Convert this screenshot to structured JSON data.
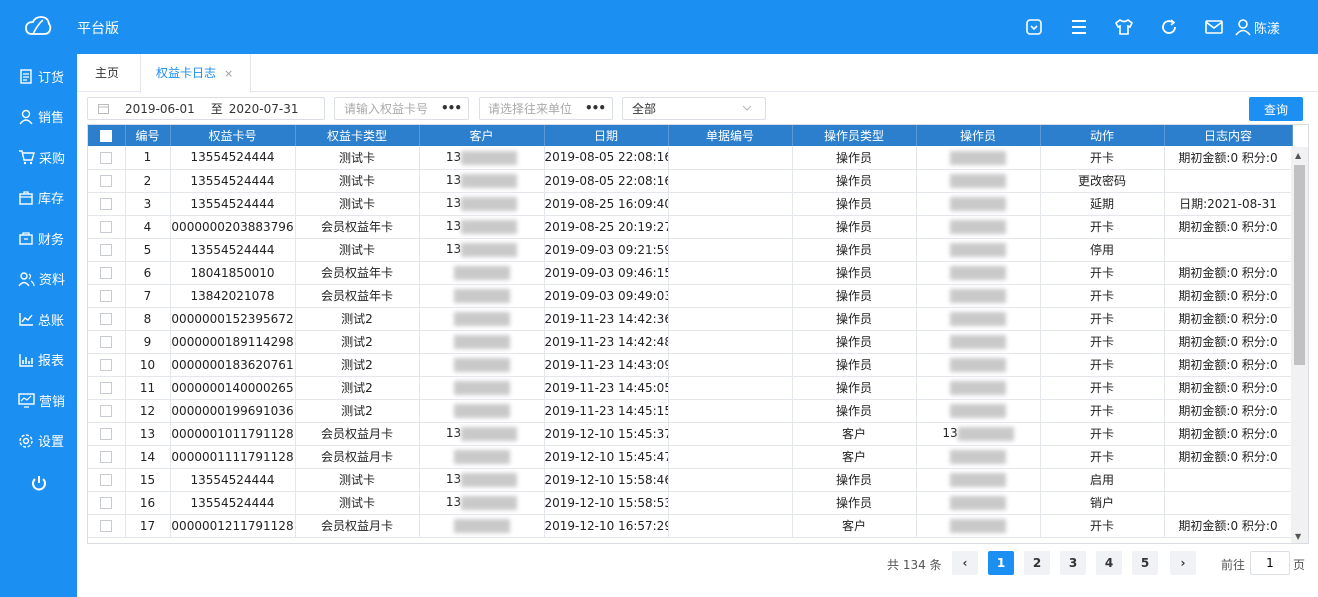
{
  "header": {
    "title": "平台版",
    "user": "陈漾"
  },
  "sidebar": {
    "items": [
      {
        "label": "订货",
        "icon": "clipboard-icon"
      },
      {
        "label": "销售",
        "icon": "user-icon"
      },
      {
        "label": "采购",
        "icon": "cart-icon"
      },
      {
        "label": "库存",
        "icon": "box-icon"
      },
      {
        "label": "财务",
        "icon": "wallet-icon"
      },
      {
        "label": "资料",
        "icon": "users-icon"
      },
      {
        "label": "总账",
        "icon": "chart-icon"
      },
      {
        "label": "报表",
        "icon": "report-icon"
      },
      {
        "label": "营销",
        "icon": "monitor-icon"
      },
      {
        "label": "设置",
        "icon": "gear-icon"
      }
    ]
  },
  "tabs": {
    "home": "主页",
    "active": "权益卡日志",
    "close": "×"
  },
  "filters": {
    "date_from": "2019-06-01",
    "date_sep": "至",
    "date_to": "2020-07-31",
    "card_placeholder": "请输入权益卡号",
    "unit_placeholder": "请选择往来单位",
    "select_value": "全部",
    "query_label": "查询"
  },
  "table": {
    "columns": [
      "编号",
      "权益卡号",
      "权益卡类型",
      "客户",
      "日期",
      "单据编号",
      "操作员类型",
      "操作员",
      "动作",
      "日志内容"
    ],
    "rows": [
      {
        "no": "1",
        "card": "13554524444",
        "type": "测试卡",
        "customer": "13",
        "date": "2019-08-05 22:08:16",
        "op_type": "操作员",
        "operator": "",
        "action": "开卡",
        "log": "期初金额:0 积分:0"
      },
      {
        "no": "2",
        "card": "13554524444",
        "type": "测试卡",
        "customer": "13",
        "date": "2019-08-05 22:08:16",
        "op_type": "操作员",
        "operator": "",
        "action": "更改密码",
        "log": ""
      },
      {
        "no": "3",
        "card": "13554524444",
        "type": "测试卡",
        "customer": "13",
        "date": "2019-08-25 16:09:40",
        "op_type": "操作员",
        "operator": "",
        "action": "延期",
        "log": "日期:2021-08-31"
      },
      {
        "no": "4",
        "card": "0000000203883796",
        "type": "会员权益年卡",
        "customer": "13",
        "date": "2019-08-25 20:19:27",
        "op_type": "操作员",
        "operator": "",
        "action": "开卡",
        "log": "期初金额:0 积分:0"
      },
      {
        "no": "5",
        "card": "13554524444",
        "type": "测试卡",
        "customer": "13",
        "date": "2019-09-03 09:21:59",
        "op_type": "操作员",
        "operator": "",
        "action": "停用",
        "log": ""
      },
      {
        "no": "6",
        "card": "18041850010",
        "type": "会员权益年卡",
        "customer": "",
        "date": "2019-09-03 09:46:15",
        "op_type": "操作员",
        "operator": "",
        "action": "开卡",
        "log": "期初金额:0 积分:0"
      },
      {
        "no": "7",
        "card": "13842021078",
        "type": "会员权益年卡",
        "customer": "",
        "date": "2019-09-03 09:49:03",
        "op_type": "操作员",
        "operator": "",
        "action": "开卡",
        "log": "期初金额:0 积分:0"
      },
      {
        "no": "8",
        "card": "0000000152395672",
        "type": "测试2",
        "customer": "",
        "date": "2019-11-23 14:42:36",
        "op_type": "操作员",
        "operator": "",
        "action": "开卡",
        "log": "期初金额:0 积分:0"
      },
      {
        "no": "9",
        "card": "0000000189114298",
        "type": "测试2",
        "customer": "",
        "date": "2019-11-23 14:42:48",
        "op_type": "操作员",
        "operator": "",
        "action": "开卡",
        "log": "期初金额:0 积分:0"
      },
      {
        "no": "10",
        "card": "0000000183620761",
        "type": "测试2",
        "customer": "",
        "date": "2019-11-23 14:43:09",
        "op_type": "操作员",
        "operator": "",
        "action": "开卡",
        "log": "期初金额:0 积分:0"
      },
      {
        "no": "11",
        "card": "0000000140000265",
        "type": "测试2",
        "customer": "",
        "date": "2019-11-23 14:45:05",
        "op_type": "操作员",
        "operator": "",
        "action": "开卡",
        "log": "期初金额:0 积分:0"
      },
      {
        "no": "12",
        "card": "0000000199691036",
        "type": "测试2",
        "customer": "",
        "date": "2019-11-23 14:45:15",
        "op_type": "操作员",
        "operator": "",
        "action": "开卡",
        "log": "期初金额:0 积分:0"
      },
      {
        "no": "13",
        "card": "0000001011791128",
        "type": "会员权益月卡",
        "customer": "13",
        "date": "2019-12-10 15:45:37",
        "op_type": "客户",
        "operator": "13",
        "action": "开卡",
        "log": "期初金额:0 积分:0"
      },
      {
        "no": "14",
        "card": "0000001111791128",
        "type": "会员权益月卡",
        "customer": "",
        "date": "2019-12-10 15:45:47",
        "op_type": "客户",
        "operator": "",
        "action": "开卡",
        "log": "期初金额:0 积分:0"
      },
      {
        "no": "15",
        "card": "13554524444",
        "type": "测试卡",
        "customer": "13",
        "date": "2019-12-10 15:58:46",
        "op_type": "操作员",
        "operator": "",
        "action": "启用",
        "log": ""
      },
      {
        "no": "16",
        "card": "13554524444",
        "type": "测试卡",
        "customer": "13",
        "date": "2019-12-10 15:58:53",
        "op_type": "操作员",
        "operator": "",
        "action": "销户",
        "log": ""
      },
      {
        "no": "17",
        "card": "0000001211791128",
        "type": "会员权益月卡",
        "customer": "",
        "date": "2019-12-10 16:57:29",
        "op_type": "客户",
        "operator": "",
        "action": "开卡",
        "log": "期初金额:0 积分:0"
      }
    ]
  },
  "pager": {
    "total": "共 134 条",
    "pages": [
      "1",
      "2",
      "3",
      "4",
      "5"
    ],
    "current": "1",
    "goto_label": "前往",
    "goto_value": "1",
    "page_suffix": "页",
    "prev": "‹",
    "next": "›"
  },
  "colors": {
    "primary": "#1c8ff3",
    "header_row": "#2b7fcc"
  }
}
